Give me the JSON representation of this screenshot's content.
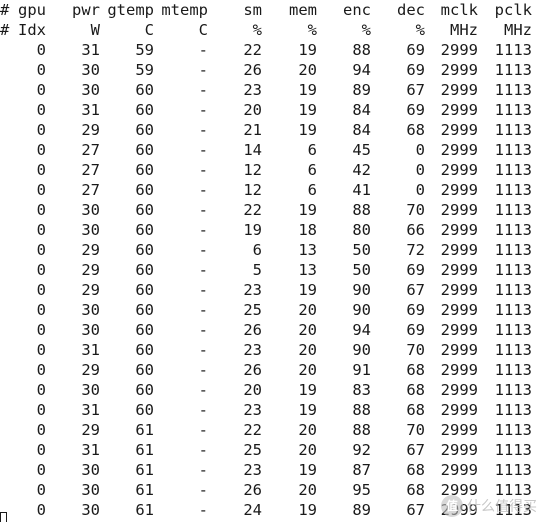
{
  "header": {
    "row1": {
      "hash": "#",
      "cols": [
        "gpu",
        "pwr",
        "gtemp",
        "mtemp",
        "sm",
        "mem",
        "enc",
        "dec",
        "mclk",
        "pclk"
      ]
    },
    "row2": {
      "hash": "#",
      "cols": [
        "Idx",
        "W",
        "C",
        "C",
        "%",
        "%",
        "%",
        "%",
        "MHz",
        "MHz"
      ]
    }
  },
  "rows": [
    [
      "0",
      "31",
      "59",
      "-",
      "22",
      "19",
      "88",
      "69",
      "2999",
      "1113"
    ],
    [
      "0",
      "30",
      "59",
      "-",
      "26",
      "20",
      "94",
      "69",
      "2999",
      "1113"
    ],
    [
      "0",
      "30",
      "60",
      "-",
      "23",
      "19",
      "89",
      "67",
      "2999",
      "1113"
    ],
    [
      "0",
      "31",
      "60",
      "-",
      "20",
      "19",
      "84",
      "69",
      "2999",
      "1113"
    ],
    [
      "0",
      "29",
      "60",
      "-",
      "21",
      "19",
      "84",
      "68",
      "2999",
      "1113"
    ],
    [
      "0",
      "27",
      "60",
      "-",
      "14",
      "6",
      "45",
      "0",
      "2999",
      "1113"
    ],
    [
      "0",
      "27",
      "60",
      "-",
      "12",
      "6",
      "42",
      "0",
      "2999",
      "1113"
    ],
    [
      "0",
      "27",
      "60",
      "-",
      "12",
      "6",
      "41",
      "0",
      "2999",
      "1113"
    ],
    [
      "0",
      "30",
      "60",
      "-",
      "22",
      "19",
      "88",
      "70",
      "2999",
      "1113"
    ],
    [
      "0",
      "30",
      "60",
      "-",
      "19",
      "18",
      "80",
      "66",
      "2999",
      "1113"
    ],
    [
      "0",
      "29",
      "60",
      "-",
      "6",
      "13",
      "50",
      "72",
      "2999",
      "1113"
    ],
    [
      "0",
      "29",
      "60",
      "-",
      "5",
      "13",
      "50",
      "69",
      "2999",
      "1113"
    ],
    [
      "0",
      "29",
      "60",
      "-",
      "23",
      "19",
      "90",
      "67",
      "2999",
      "1113"
    ],
    [
      "0",
      "30",
      "60",
      "-",
      "25",
      "20",
      "90",
      "69",
      "2999",
      "1113"
    ],
    [
      "0",
      "30",
      "60",
      "-",
      "26",
      "20",
      "94",
      "69",
      "2999",
      "1113"
    ],
    [
      "0",
      "31",
      "60",
      "-",
      "23",
      "20",
      "90",
      "70",
      "2999",
      "1113"
    ],
    [
      "0",
      "29",
      "60",
      "-",
      "26",
      "20",
      "91",
      "68",
      "2999",
      "1113"
    ],
    [
      "0",
      "30",
      "60",
      "-",
      "20",
      "19",
      "83",
      "68",
      "2999",
      "1113"
    ],
    [
      "0",
      "31",
      "60",
      "-",
      "23",
      "19",
      "88",
      "68",
      "2999",
      "1113"
    ],
    [
      "0",
      "29",
      "61",
      "-",
      "22",
      "20",
      "88",
      "70",
      "2999",
      "1113"
    ],
    [
      "0",
      "31",
      "61",
      "-",
      "25",
      "20",
      "92",
      "67",
      "2999",
      "1113"
    ],
    [
      "0",
      "30",
      "61",
      "-",
      "23",
      "19",
      "87",
      "68",
      "2999",
      "1113"
    ],
    [
      "0",
      "30",
      "61",
      "-",
      "26",
      "20",
      "95",
      "68",
      "2999",
      "1113"
    ],
    [
      "0",
      "30",
      "61",
      "-",
      "24",
      "19",
      "89",
      "67",
      "2999",
      "1113"
    ]
  ],
  "watermark": {
    "logo_text": "值",
    "text": "什么值得买"
  }
}
